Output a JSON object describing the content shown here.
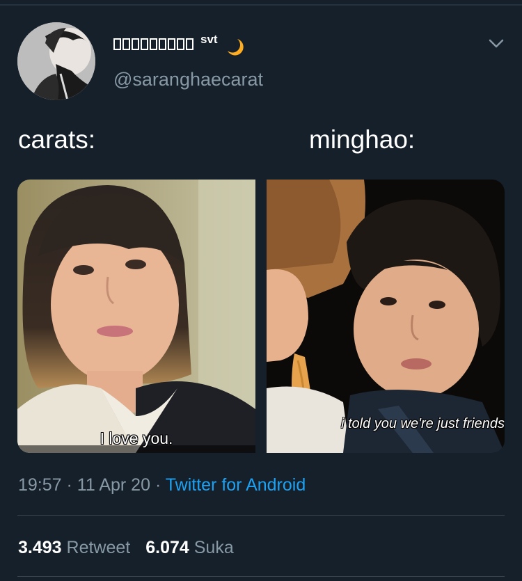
{
  "user": {
    "display_name_glyph_count": 9,
    "display_name_suffix": "svt",
    "handle": "@saranghaecarat",
    "avatar": "profile-photo",
    "badge_icon": "crescent-moon-icon"
  },
  "tweet": {
    "caption_left": "carats:",
    "caption_right": "minghao:",
    "subtitle_left": "I love you.",
    "subtitle_right": "i told you we're just friends",
    "time": "19:57",
    "date": "11 Apr 20",
    "source": "Twitter for Android"
  },
  "stats": {
    "retweets": "3.493",
    "retweet_label": "Retweet",
    "likes": "6.074",
    "like_label": "Suka"
  },
  "colors": {
    "background": "#15202b",
    "secondary_text": "#8899a6",
    "link": "#1da1f2",
    "moon": "#ffad1f"
  }
}
